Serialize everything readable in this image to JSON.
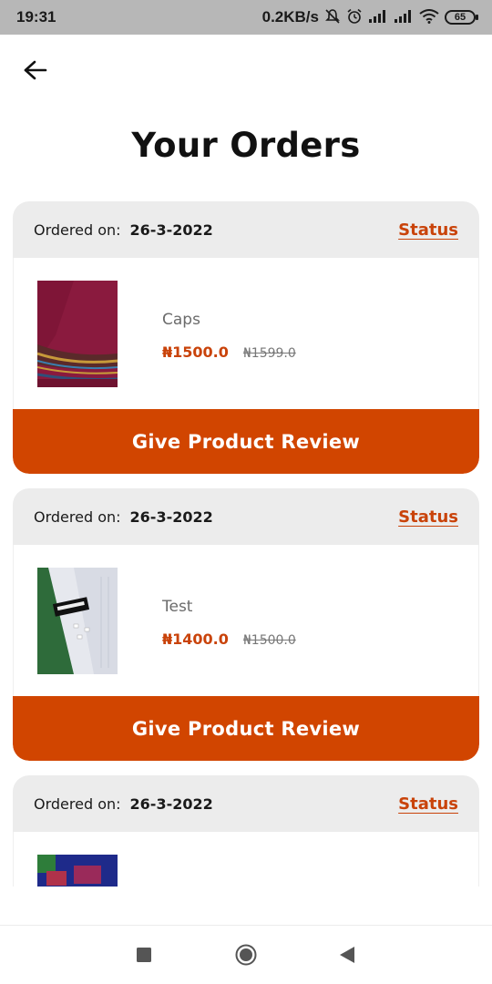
{
  "status_bar": {
    "time": "19:31",
    "net_speed": "0.2KB/s",
    "battery": "65",
    "icons": [
      "mute-icon",
      "alarm-icon",
      "signal-icon",
      "signal-icon",
      "wifi-icon",
      "battery-icon"
    ]
  },
  "header": {
    "back_icon": "arrow-left-icon",
    "title": "Your Orders"
  },
  "orders": [
    {
      "ordered_label": "Ordered on:",
      "date": "26-3-2022",
      "status_label": "Status",
      "product_name": "Caps",
      "price": "₦1500.0",
      "old_price": "₦1599.0",
      "review_label": "Give Product Review"
    },
    {
      "ordered_label": "Ordered on:",
      "date": "26-3-2022",
      "status_label": "Status",
      "product_name": "Test",
      "price": "₦1400.0",
      "old_price": "₦1500.0",
      "review_label": "Give Product Review"
    },
    {
      "ordered_label": "Ordered on:",
      "date": "26-3-2022",
      "status_label": "Status"
    }
  ],
  "colors": {
    "accent": "#d14500",
    "status_link": "#c9430a",
    "card_header_bg": "#ececec",
    "status_bar_bg": "#b7b7b7"
  },
  "nav_bar": {
    "icons": [
      "recents-square-icon",
      "home-circle-icon",
      "back-triangle-icon"
    ]
  }
}
